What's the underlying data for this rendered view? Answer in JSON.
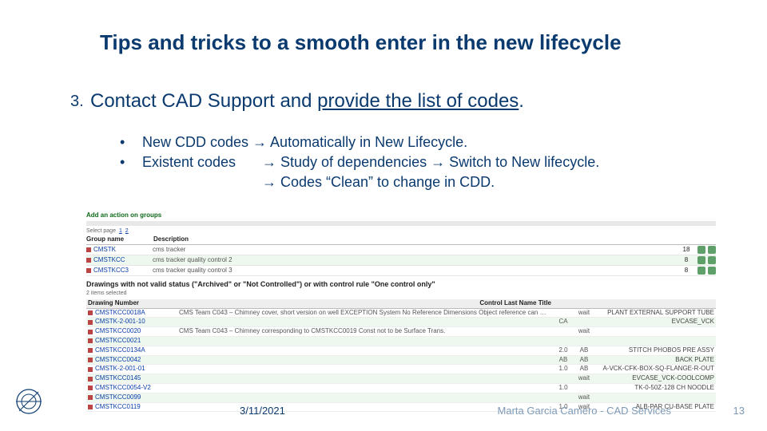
{
  "title": "Tips and tricks to a smooth enter in the new lifecycle",
  "list_number": "3.",
  "heading_plain": "Contact CAD Support and ",
  "heading_underlined": "provide the list of codes",
  "heading_tail": ".",
  "bullets": {
    "b1": "New CDD codes → Automatically in New Lifecycle.",
    "b2a": "Existent codes",
    "b2b": "→ Study of dependencies → Switch to New lifecycle.",
    "b3": "→ Codes “Clean” to change in CDD."
  },
  "figure": {
    "add_action": "Add an action on groups",
    "page_label": "Select page",
    "pages": [
      "1",
      "2"
    ],
    "group_header": {
      "name": "Group name",
      "desc": "Description"
    },
    "groups": [
      {
        "name": "CMSTK",
        "desc": "cms tracker",
        "n": "18"
      },
      {
        "name": "CMSTKCC",
        "desc": "cms tracker quality control 2",
        "n": "8"
      },
      {
        "name": "CMSTKCC3",
        "desc": "cms tracker quality control 3",
        "n": "8"
      }
    ],
    "section": "Drawings with not valid status (\"Archived\" or \"Not Controlled\") or with control rule \"One control only\"",
    "tiny": "2 items selected",
    "drw_header": {
      "num": "Drawing Number",
      "rest": "Control  Last Name  Title"
    },
    "drawings": [
      {
        "num": "CMSTKCC0018A",
        "desc": "CMS Team C043 – Chimney cover, short version on well EXCEPTION System No Reference Dimensions Object reference can …",
        "c1": "",
        "c2": "wait",
        "title": "PLANT EXTERNAL SUPPORT TUBE"
      },
      {
        "num": "CMSTK-2-001-10",
        "desc": "",
        "c1": "CA",
        "c2": "",
        "title": "EVCASE_VCK"
      },
      {
        "num": "CMSTKCC0020",
        "desc": "CMS Team C043 – Chimney corresponding to CMSTKCC0019 Const not to be Surface Trans.",
        "c1": "",
        "c2": "wait",
        "title": ""
      },
      {
        "num": "CMSTKCC0021",
        "desc": "",
        "c1": "",
        "c2": "",
        "title": ""
      },
      {
        "num": "CMSTKCC0134A",
        "desc": "",
        "c1": "2.0",
        "c2": "AB",
        "title": "STITCH PHOBOS PRE ASSY"
      },
      {
        "num": "CMSTKCC0042",
        "desc": "",
        "c1": "AB",
        "c2": "AB",
        "title": "BACK PLATE"
      },
      {
        "num": "CMSTK-2-001-01",
        "desc": "",
        "c1": "1.0",
        "c2": "AB",
        "title": "A-VCK-CFK-BOX-SQ-FLANGE-R-OUT"
      },
      {
        "num": "CMSTKCC0145",
        "desc": "",
        "c1": "",
        "c2": "wait",
        "title": "EVCASE_VCK-COOLCOMP"
      },
      {
        "num": "CMSTKCC0054-V2",
        "desc": "",
        "c1": "1.0",
        "c2": "",
        "title": "TK-0-50Z-128 CH NOODLE"
      },
      {
        "num": "CMSTKCC0099",
        "desc": "",
        "c1": "",
        "c2": "wait",
        "title": ""
      },
      {
        "num": "CMSTKCC0119",
        "desc": "",
        "c1": "1.0",
        "c2": "wait",
        "title": "ALB-PAR CU-BASE PLATE"
      }
    ]
  },
  "footer": {
    "date": "3/11/2021",
    "author": "Marta Garcia Camero - CAD Services",
    "page": "13"
  }
}
